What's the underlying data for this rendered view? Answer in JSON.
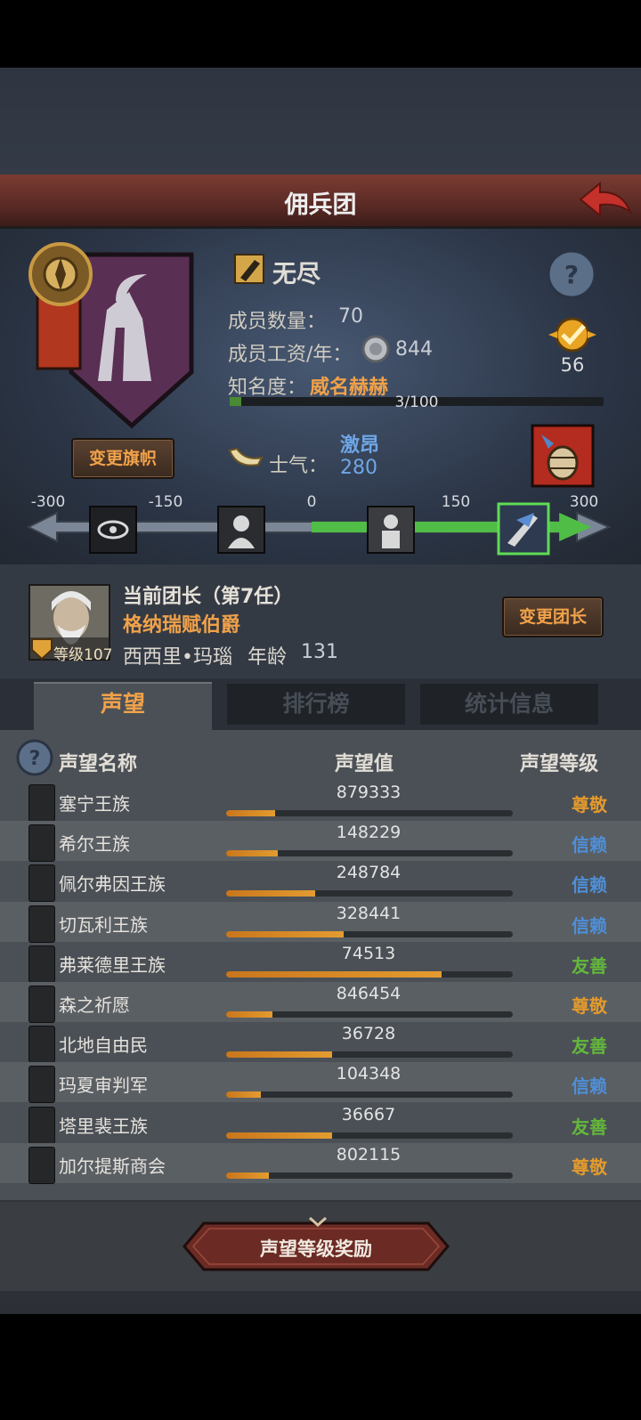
{
  "header": {
    "title": "佣兵团"
  },
  "mercenary": {
    "name": "无尽",
    "members_label": "成员数量：",
    "members": "70",
    "salary_label": "成员工资/年：",
    "salary": "844",
    "fame_label": "知名度：",
    "fame_value": "威名赫赫",
    "fame_progress": "3/100",
    "fame_fraction": 0.03,
    "badge_count": "56",
    "change_banner": "变更旗帜",
    "morale_label": "士气：",
    "morale_state": "激昂",
    "morale_value": "280"
  },
  "morale_scale": {
    "ticks": [
      "-300",
      "-150",
      "0",
      "150",
      "300"
    ],
    "value": 280
  },
  "leader": {
    "title": "当前团长（第7任）",
    "rank_name": "格纳瑞赋伯爵",
    "level_label": "等级107",
    "name": "西西里•玛瑙",
    "age_label": "年龄",
    "age": "131",
    "change_button": "变更团长"
  },
  "tabs": [
    {
      "label": "声望",
      "active": true
    },
    {
      "label": "排行榜",
      "active": false
    },
    {
      "label": "统计信息",
      "active": false
    }
  ],
  "columns": {
    "name": "声望名称",
    "value": "声望值",
    "level": "声望等级"
  },
  "factions": [
    {
      "name": "塞宁王族",
      "value": "879333",
      "fill": 0.17,
      "level": "尊敬",
      "color": "#e39a2c"
    },
    {
      "name": "希尔王族",
      "value": "148229",
      "fill": 0.18,
      "level": "信赖",
      "color": "#4f8fd8"
    },
    {
      "name": "佩尔弗因王族",
      "value": "248784",
      "fill": 0.31,
      "level": "信赖",
      "color": "#4f8fd8"
    },
    {
      "name": "切瓦利王族",
      "value": "328441",
      "fill": 0.41,
      "level": "信赖",
      "color": "#4f8fd8"
    },
    {
      "name": "弗莱德里王族",
      "value": "74513",
      "fill": 0.75,
      "level": "友善",
      "color": "#63b83c"
    },
    {
      "name": "森之祈愿",
      "value": "846454",
      "fill": 0.16,
      "level": "尊敬",
      "color": "#e39a2c"
    },
    {
      "name": "北地自由民",
      "value": "36728",
      "fill": 0.37,
      "level": "友善",
      "color": "#63b83c"
    },
    {
      "name": "玛夏审判军",
      "value": "104348",
      "fill": 0.12,
      "level": "信赖",
      "color": "#4f8fd8"
    },
    {
      "name": "塔里裴王族",
      "value": "36667",
      "fill": 0.37,
      "level": "友善",
      "color": "#63b83c"
    },
    {
      "name": "加尔提斯商会",
      "value": "802115",
      "fill": 0.15,
      "level": "尊敬",
      "color": "#e39a2c"
    }
  ],
  "reward_button": "声望等级奖励"
}
